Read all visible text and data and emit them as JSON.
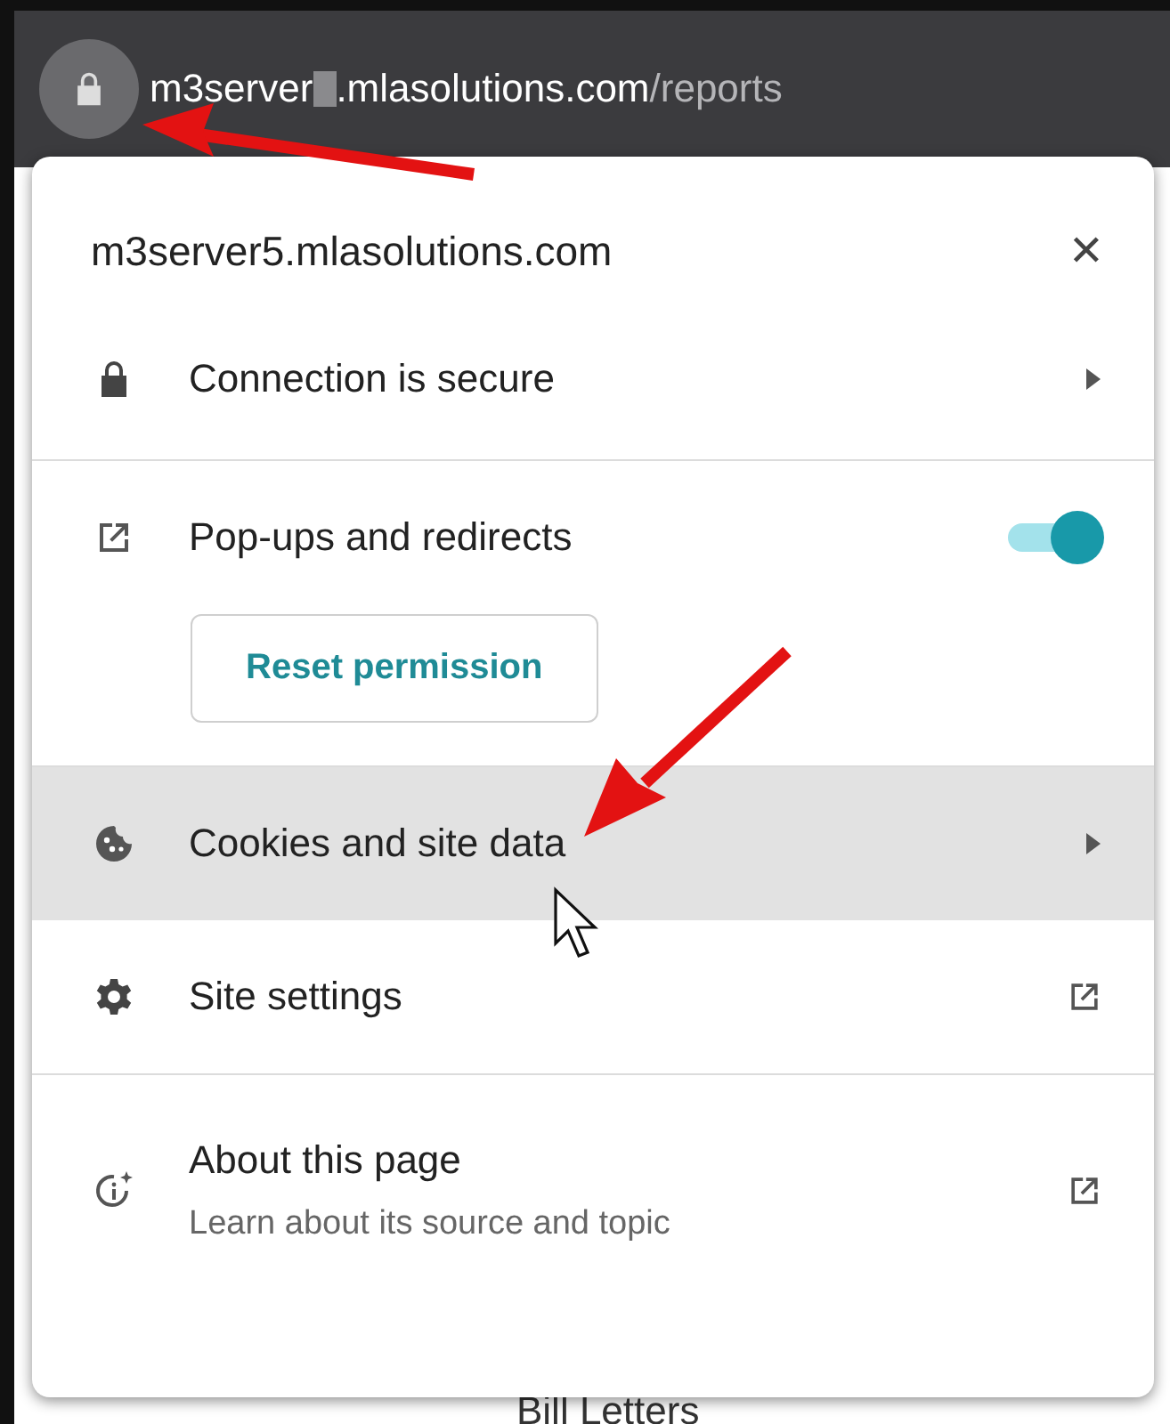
{
  "address_bar": {
    "host_start": "m3server",
    "redacted": true,
    "host_end": ".mlasolutions.com",
    "path": "/reports"
  },
  "popup": {
    "title": "m3server5.mlasolutions.com",
    "close": "✕",
    "sections": [
      {
        "items": [
          {
            "kind": "submenu",
            "label": "Connection is secure",
            "highlighted": false
          }
        ]
      },
      {
        "items": [
          {
            "kind": "toggle",
            "label": "Pop-ups and redirects",
            "on": true,
            "button": "Reset permission",
            "highlighted": false
          }
        ]
      },
      {
        "items": [
          {
            "kind": "submenu",
            "label": "Cookies and site data",
            "highlighted": true
          },
          {
            "kind": "external",
            "label": "Site settings",
            "highlighted": false
          }
        ]
      },
      {
        "items": [
          {
            "kind": "external",
            "label": "About this page",
            "subtitle": "Learn about its source and topic",
            "highlighted": false
          }
        ]
      }
    ]
  },
  "background_page": {
    "item": "Bill Letters"
  }
}
